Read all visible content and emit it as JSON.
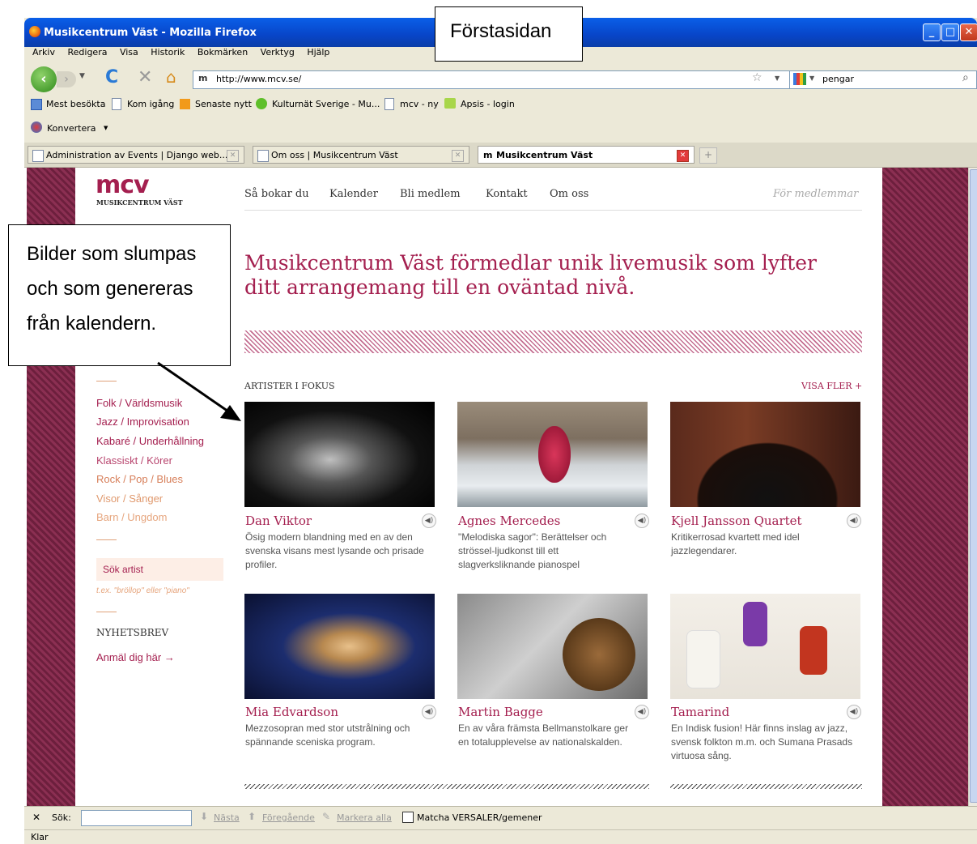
{
  "window": {
    "title": "Musikcentrum Väst - Mozilla Firefox"
  },
  "menu": [
    "Arkiv",
    "Redigera",
    "Visa",
    "Historik",
    "Bokmärken",
    "Verktyg",
    "Hjälp"
  ],
  "navbar": {
    "url": "http://www.mcv.se/",
    "search_value": "pengar"
  },
  "bookmarks": [
    "Mest besökta",
    "Kom igång",
    "Senaste nytt",
    "Kulturnät Sverige - Mu...",
    "mcv - ny",
    "Apsis - login"
  ],
  "convert_label": "Konvertera",
  "tabs": [
    {
      "label": "Administration av Events | Django web...",
      "active": false
    },
    {
      "label": "Om oss | Musikcentrum Väst",
      "active": false
    },
    {
      "label": "Musikcentrum Väst",
      "active": true
    }
  ],
  "site": {
    "logo_text": "mcv",
    "logo_sub": "MUSIKCENTRUM VÄST",
    "nav": [
      "Så bokar du",
      "Kalender",
      "Bli medlem",
      "Kontakt",
      "Om oss"
    ],
    "members_link": "För medlemmar",
    "headline": "Musikcentrum Väst förmedlar unik livemusik som lyfter ditt arrangemang till en oväntad nivå.",
    "categories": [
      "Folk / Världsmusik",
      "Jazz / Improvisation",
      "Kabaré / Underhållning",
      "Klassiskt / Körer",
      "Rock / Pop / Blues",
      "Visor / Sånger",
      "Barn / Ungdom"
    ],
    "search_label": "Sök artist",
    "search_hint": "t.ex. \"bröllop\" eller \"piano\"",
    "newsletter_heading": "NYHETSBREV",
    "newsletter_link": "Anmäl dig här →",
    "section_title": "ARTISTER I FOKUS",
    "more_link": "VISA FLER +",
    "artists": [
      {
        "name": "Dan Viktor",
        "desc": "Ösig modern blandning med en av den svenska visans mest lysande och prisade profiler."
      },
      {
        "name": "Agnes Mercedes",
        "desc": "\"Melodiska sagor\": Berättelser och strössel-ljudkonst till ett slagverksliknande pianospel"
      },
      {
        "name": "Kjell Jansson Quartet",
        "desc": "Kritikerrosad kvartett med idel jazzlegendarer."
      },
      {
        "name": "Mia Edvardson",
        "desc": "Mezzosopran med stor utstrålning och spännande sceniska program."
      },
      {
        "name": "Martin Bagge",
        "desc": "En av våra främsta Bellmanstolkare ger en totalupplevelse av nationalskalden."
      },
      {
        "name": "Tamarind",
        "desc": "En Indisk fusion! Här finns inslag av jazz, svensk folkton m.m. och Sumana Prasads virtuosa sång."
      }
    ]
  },
  "findbar": {
    "label": "Sök:",
    "next": "Nästa",
    "prev": "Föregående",
    "highlight": "Markera alla",
    "match_case": "Matcha VERSALER/gemener"
  },
  "status": "Klar",
  "callouts": {
    "top": "Förstasidan",
    "left": "Bilder som slumpas och som genereras från kalendern."
  }
}
